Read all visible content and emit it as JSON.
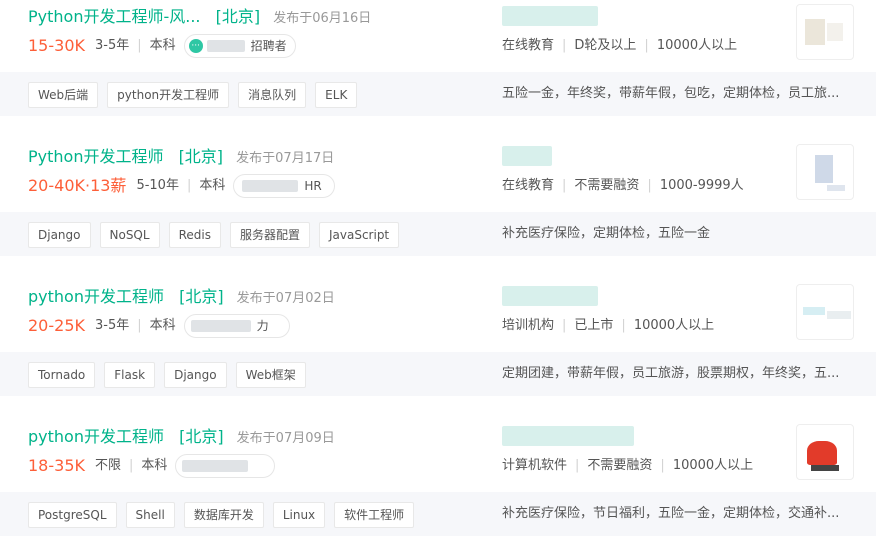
{
  "jobs": [
    {
      "title": "Python开发工程师-风...",
      "city": "[北京]",
      "published": "发布于06月16日",
      "salary": "15-30K",
      "experience": "3-5年",
      "education": "本科",
      "recruiter_label": "招聘者",
      "company_meta": [
        "在线教育",
        "D轮及以上",
        "10000人以上"
      ],
      "tags": [
        "Web后端",
        "python开发工程师",
        "消息队列",
        "ELK"
      ],
      "benefits": "五险一金，年终奖，带薪年假，包吃，定期体检，员工旅..."
    },
    {
      "title": "Python开发工程师",
      "city": "[北京]",
      "published": "发布于07月17日",
      "salary": "20-40K·13薪",
      "experience": "5-10年",
      "education": "本科",
      "recruiter_label": "HR",
      "company_meta": [
        "在线教育",
        "不需要融资",
        "1000-9999人"
      ],
      "tags": [
        "Django",
        "NoSQL",
        "Redis",
        "服务器配置",
        "JavaScript"
      ],
      "benefits": "补充医疗保险，定期体检，五险一金"
    },
    {
      "title": "python开发工程师",
      "city": "[北京]",
      "published": "发布于07月02日",
      "salary": "20-25K",
      "experience": "3-5年",
      "education": "本科",
      "recruiter_label": "力",
      "company_meta": [
        "培训机构",
        "已上市",
        "10000人以上"
      ],
      "tags": [
        "Tornado",
        "Flask",
        "Django",
        "Web框架"
      ],
      "benefits": "定期团建，带薪年假，员工旅游，股票期权，年终奖，五..."
    },
    {
      "title": "python开发工程师",
      "city": "[北京]",
      "published": "发布于07月09日",
      "salary": "18-35K",
      "experience": "不限",
      "education": "本科",
      "recruiter_label": "",
      "company_meta": [
        "计算机软件",
        "不需要融资",
        "10000人以上"
      ],
      "tags": [
        "PostgreSQL",
        "Shell",
        "数据库开发",
        "Linux",
        "软件工程师"
      ],
      "benefits": "补充医疗保险，节日福利，五险一金，定期体检，交通补..."
    }
  ]
}
